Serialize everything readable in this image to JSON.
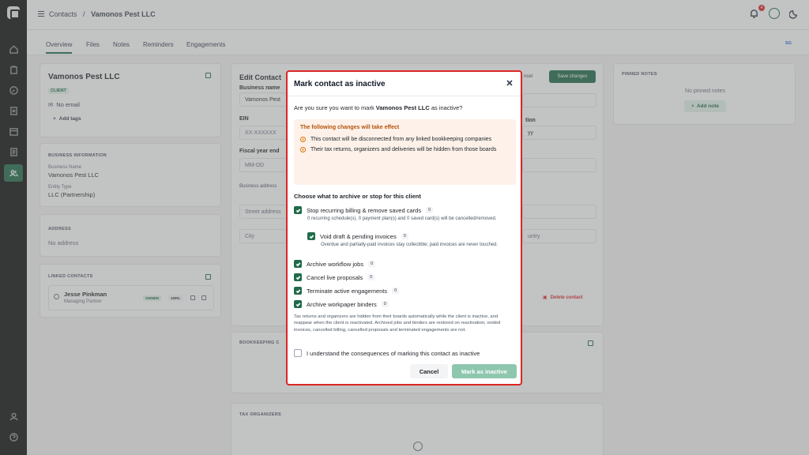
{
  "topbar": {
    "breadcrumb_root": "Contacts",
    "breadcrumb_sep": "/",
    "breadcrumb_current": "Vamonos Pest LLC",
    "notification_count": "4"
  },
  "tabs": [
    "Overview",
    "Files",
    "Notes",
    "Reminders",
    "Engagements"
  ],
  "tabs_right": "SG",
  "contact": {
    "name": "Vamonos Pest LLC",
    "badge": "CLIENT",
    "email": "No email",
    "add_tags": "Add tags"
  },
  "business_info": {
    "heading": "BUSINESS INFORMATION",
    "name_label": "Business Name",
    "name_value": "Vamonos Pest LLC",
    "entity_label": "Entity Type",
    "entity_value": "LLC (Partnership)"
  },
  "address": {
    "heading": "ADDRESS",
    "value": "No address"
  },
  "linked": {
    "heading": "LINKED CONTACTS",
    "name": "Jesse Pinkman",
    "role": "Managing Partner",
    "owner": "OWNER",
    "pct": "100%"
  },
  "edit": {
    "title": "Edit Contact",
    "business_name_label": "Business name",
    "business_name_value": "Vamonos Pest",
    "ein_label": "EIN",
    "ein_placeholder": "XX-XXXXXX",
    "fiscal_label": "Fiscal year end",
    "fiscal_placeholder": "MM-DD",
    "address_label": "Business address",
    "street_placeholder": "Street address",
    "city_placeholder": "City",
    "country_placeholder": "untry",
    "date_placeholder": "yy",
    "formation_label": "tion",
    "cancel": "ncel",
    "save": "Save changes",
    "delete": "Delete contact",
    "bookkeeping": "BOOKKEEPING C",
    "tax_organizers": "TAX ORGANIZERS"
  },
  "pinned": {
    "heading": "PINNED NOTES",
    "empty": "No pinned notes",
    "add": "Add note"
  },
  "modal": {
    "title": "Mark contact as inactive",
    "question_prefix": "Are you sure you want to mark ",
    "question_name": "Vamonos Pest LLC",
    "question_suffix": " as inactive?",
    "warn_heading": "The following changes will take effect",
    "warn_items": [
      "This contact will be disconnected from any linked bookkeeping companies",
      "Their tax returns, organizers and deliveries will be hidden from those boards"
    ],
    "choose_heading": "Choose what to archive or stop for this client",
    "opt_billing": "Stop recurring billing & remove saved cards",
    "opt_billing_count": "0",
    "opt_billing_note": "0 recurring schedule(s), 0 payment plan(s) and 0 saved card(s) will be cancelled/removed.",
    "opt_invoices": "Void draft & pending invoices",
    "opt_invoices_count": "0",
    "opt_invoices_note": "Overdue and partially-paid invoices stay collectible; paid invoices are never touched.",
    "opt_jobs": "Archive workflow jobs",
    "opt_jobs_count": "0",
    "opt_proposals": "Cancel live proposals",
    "opt_proposals_count": "0",
    "opt_engagements": "Terminate active engagements",
    "opt_engagements_count": "0",
    "opt_binders": "Archive workpaper binders",
    "opt_binders_count": "0",
    "footnote": "Tax returns and organizers are hidden from their boards automatically while the client is inactive, and reappear when the client is reactivated. Archived jobs and binders are restored on reactivation; voided invoices, cancelled billing, cancelled proposals and terminated engagements are not.",
    "understand": "I understand the consequences of marking this contact as inactive",
    "cancel": "Cancel",
    "confirm": "Mark as inactive"
  }
}
